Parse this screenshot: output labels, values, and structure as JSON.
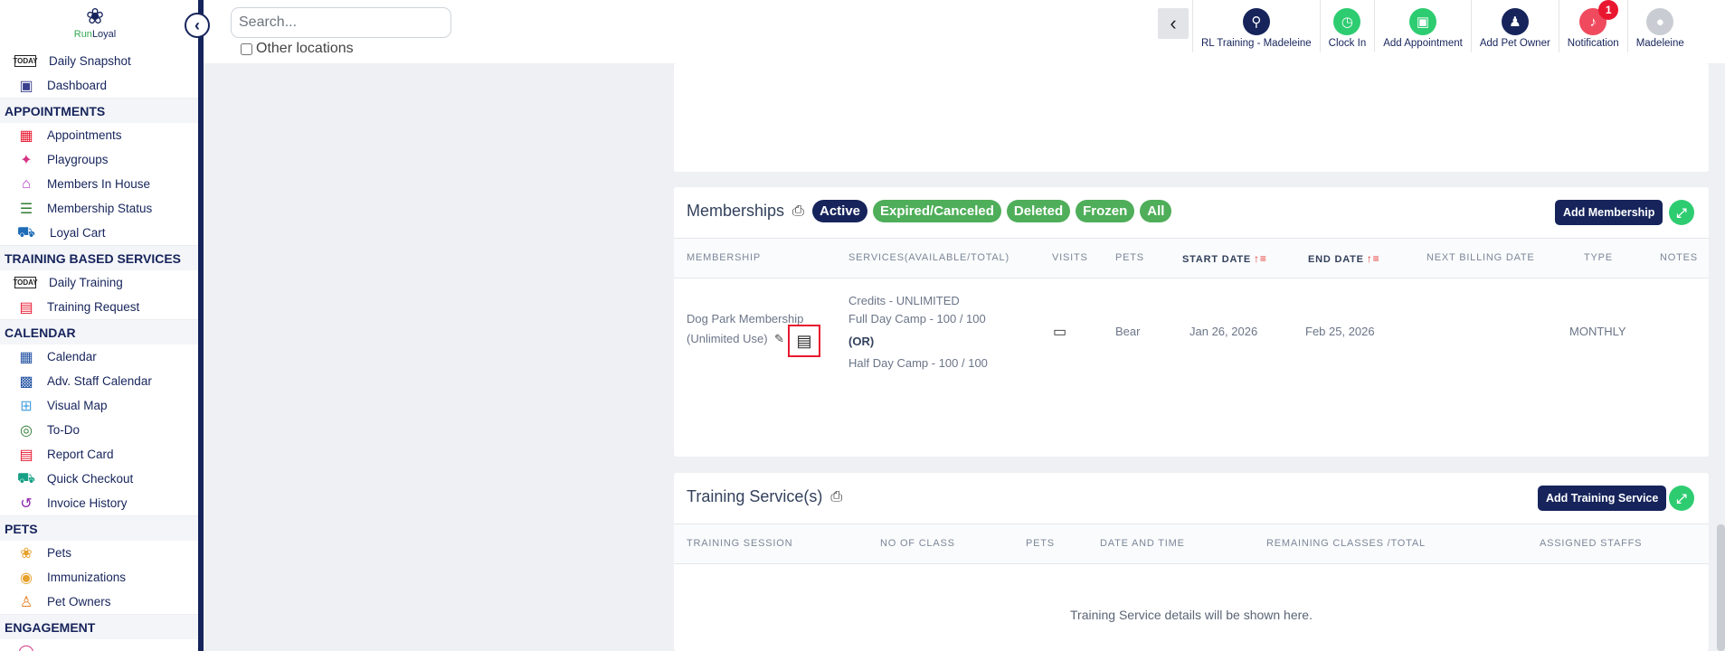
{
  "logo": {
    "text_run": "Run",
    "text_loyal": "Loyal"
  },
  "search": {
    "placeholder": "Search...",
    "other_locations": "Other locations"
  },
  "sidebar": {
    "top_items": [
      {
        "label": "Daily Snapshot",
        "icon": "today-icon"
      },
      {
        "label": "Dashboard",
        "icon": "dashboard-icon"
      }
    ],
    "sections": [
      {
        "title": "APPOINTMENTS",
        "items": [
          {
            "label": "Appointments",
            "icon": "appointments-icon"
          },
          {
            "label": "Playgroups",
            "icon": "playgroups-icon"
          },
          {
            "label": "Members In House",
            "icon": "members-in-house-icon"
          },
          {
            "label": "Membership Status",
            "icon": "membership-status-icon"
          },
          {
            "label": "Loyal Cart",
            "icon": "cart-icon"
          }
        ]
      },
      {
        "title": "TRAINING BASED SERVICES",
        "items": [
          {
            "label": "Daily Training",
            "icon": "daily-training-icon"
          },
          {
            "label": "Training Request",
            "icon": "training-request-icon"
          }
        ]
      },
      {
        "title": "CALENDAR",
        "items": [
          {
            "label": "Calendar",
            "icon": "calendar-icon"
          },
          {
            "label": "Adv. Staff Calendar",
            "icon": "staff-calendar-icon"
          },
          {
            "label": "Visual Map",
            "icon": "map-icon"
          },
          {
            "label": "To-Do",
            "icon": "todo-icon"
          },
          {
            "label": "Report Card",
            "icon": "report-card-icon"
          },
          {
            "label": "Quick Checkout",
            "icon": "checkout-icon"
          },
          {
            "label": "Invoice History",
            "icon": "invoice-history-icon"
          }
        ]
      },
      {
        "title": "PETS",
        "items": [
          {
            "label": "Pets",
            "icon": "paw-icon"
          },
          {
            "label": "Immunizations",
            "icon": "immunization-icon"
          },
          {
            "label": "Pet Owners",
            "icon": "pet-owner-icon"
          }
        ]
      },
      {
        "title": "ENGAGEMENT",
        "items": []
      }
    ]
  },
  "topbar": {
    "actions": [
      {
        "label": "RL Training - Madeleine",
        "color": "#16245b",
        "icon": "location-pin-icon"
      },
      {
        "label": "Clock In",
        "color": "#2ecc71",
        "icon": "clock-icon"
      },
      {
        "label": "Add Appointment",
        "color": "#2ecc71",
        "icon": "add-appointment-icon"
      },
      {
        "label": "Add Pet Owner",
        "color": "#16245b",
        "icon": "add-user-icon"
      },
      {
        "label": "Notification",
        "color": "#f04a5e",
        "icon": "bell-icon",
        "badge": "1"
      },
      {
        "label": "Madeleine",
        "color": "#c9cdd3",
        "icon": "avatar-icon"
      }
    ]
  },
  "memberships": {
    "title": "Memberships",
    "filters": [
      "Active",
      "Expired/Canceled",
      "Deleted",
      "Frozen",
      "All"
    ],
    "add_label": "Add Membership",
    "columns": [
      "MEMBERSHIP",
      "SERVICES(AVAILABLE/TOTAL)",
      "VISITS",
      "PETS",
      "START DATE",
      "END DATE",
      "NEXT BILLING DATE",
      "TYPE",
      "NOTES"
    ],
    "row": {
      "name_line1": "Dog Park Membership",
      "name_line2": "(Unlimited Use)",
      "services": [
        "Credits - UNLIMITED",
        "Full Day Camp - 100 / 100",
        "(OR)",
        "Half Day Camp - 100 / 100"
      ],
      "pets": "Bear",
      "start_date": "Jan 26, 2026",
      "end_date": "Feb 25, 2026",
      "type": "MONTHLY"
    }
  },
  "training": {
    "title": "Training Service(s)",
    "add_label": "Add Training Service",
    "columns": [
      "TRAINING SESSION",
      "NO OF CLASS",
      "PETS",
      "DATE AND TIME",
      "REMAINING CLASSES /TOTAL",
      "ASSIGNED STAFFS"
    ],
    "empty": "Training Service details will be shown here."
  },
  "colors": {
    "navy": "#16245b",
    "green": "#4fae5a",
    "accent_green": "#2ecc71",
    "red": "#e8172f"
  }
}
